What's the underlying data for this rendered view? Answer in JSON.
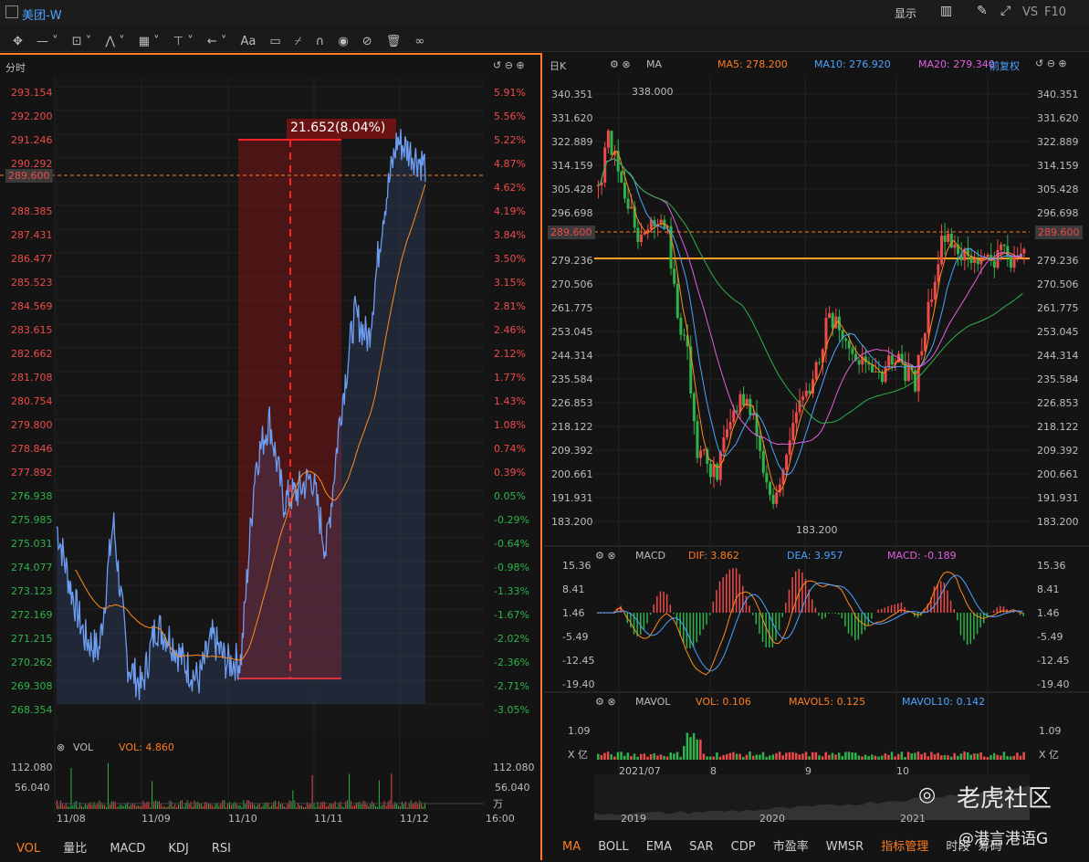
{
  "header": {
    "title": "美团-W",
    "display_label": "显示",
    "vs_label": "VS",
    "f10_label": "F10"
  },
  "left": {
    "period": "分时",
    "price_ticks": [
      "293.154",
      "292.200",
      "291.246",
      "290.292",
      "289.600",
      "288.385",
      "287.431",
      "286.477",
      "285.523",
      "284.569",
      "283.615",
      "282.662",
      "281.708",
      "280.754",
      "279.800",
      "278.846",
      "277.892",
      "276.938",
      "275.985",
      "275.031",
      "274.077",
      "273.123",
      "272.169",
      "271.215",
      "270.262",
      "269.308",
      "268.354"
    ],
    "pct_ticks": [
      "5.91%",
      "5.56%",
      "5.22%",
      "4.87%",
      "4.62%",
      "4.19%",
      "3.84%",
      "3.50%",
      "3.15%",
      "2.81%",
      "2.46%",
      "2.12%",
      "1.77%",
      "1.43%",
      "1.08%",
      "0.74%",
      "0.39%",
      "0.05%",
      "-0.29%",
      "-0.64%",
      "-0.98%",
      "-1.33%",
      "-1.67%",
      "-2.02%",
      "-2.36%",
      "-2.71%",
      "-3.05%"
    ],
    "measure_label": "21.652(8.04%)",
    "vol_title": "VOL",
    "vol_value": "VOL: 4.860",
    "vol_ticks": [
      "112.080",
      "56.040"
    ],
    "vol_unit": "万",
    "dates": [
      "11/08",
      "11/09",
      "11/10",
      "11/11",
      "11/12",
      "16:00"
    ],
    "tabs": [
      "VOL",
      "量比",
      "MACD",
      "KDJ",
      "RSI"
    ]
  },
  "right": {
    "period": "日K",
    "ind_name": "MA",
    "ma5": "MA5: 278.200",
    "ma10": "MA10: 276.920",
    "ma20": "MA20: 279.340",
    "adjust": "前复权",
    "price_ticks": [
      "340.351",
      "331.620",
      "322.889",
      "314.159",
      "305.428",
      "296.698",
      "289.600",
      "279.236",
      "270.506",
      "261.775",
      "253.045",
      "244.314",
      "235.584",
      "226.853",
      "218.122",
      "209.392",
      "200.661",
      "191.931",
      "183.200"
    ],
    "high_label": "338.000",
    "low_label": "183.200",
    "macd_name": "MACD",
    "dif": "DIF: 3.862",
    "dea": "DEA: 3.957",
    "macd_val": "MACD: -0.189",
    "macd_ticks": [
      "15.36",
      "8.41",
      "1.46",
      "-5.49",
      "-12.45",
      "-19.40"
    ],
    "vol_name": "MAVOL",
    "vol": "VOL: 0.106",
    "mavol5": "MAVOL5: 0.125",
    "mavol10": "MAVOL10: 0.142",
    "vol_ticks": [
      "1.09",
      "X 亿"
    ],
    "months": [
      "2021/07",
      "8",
      "9",
      "10"
    ],
    "years": [
      "2019",
      "2020",
      "2021"
    ],
    "tabs": [
      "MA",
      "BOLL",
      "EMA",
      "SAR",
      "CDP",
      "市盈率",
      "WMSR",
      "指标管理",
      "时段",
      "筹码"
    ],
    "watermark": "老虎社区",
    "watermark2": "@港言港语G"
  },
  "chart_data": [
    {
      "type": "line",
      "title": "",
      "series": [
        {
          "name": "",
          "values": [
            275.5,
            273.0,
            271.0,
            270.5,
            275.7,
            270.0,
            269.0,
            271.5,
            271.0,
            270.0,
            269.3,
            271.0,
            270.0,
            270.1,
            277.9,
            279.8,
            276.5,
            276.9,
            277.5,
            274.5,
            280.0,
            284.0,
            283.0,
            288.0,
            291.0,
            290.5,
            290.0
          ]
        }
      ],
      "ylim": [
        268.354,
        293.154
      ]
    },
    {
      "type": "bar",
      "title": "",
      "categories": [
        "2021/07",
        "8",
        "9",
        "10"
      ],
      "ylim": [
        183.2,
        340.351
      ]
    }
  ]
}
